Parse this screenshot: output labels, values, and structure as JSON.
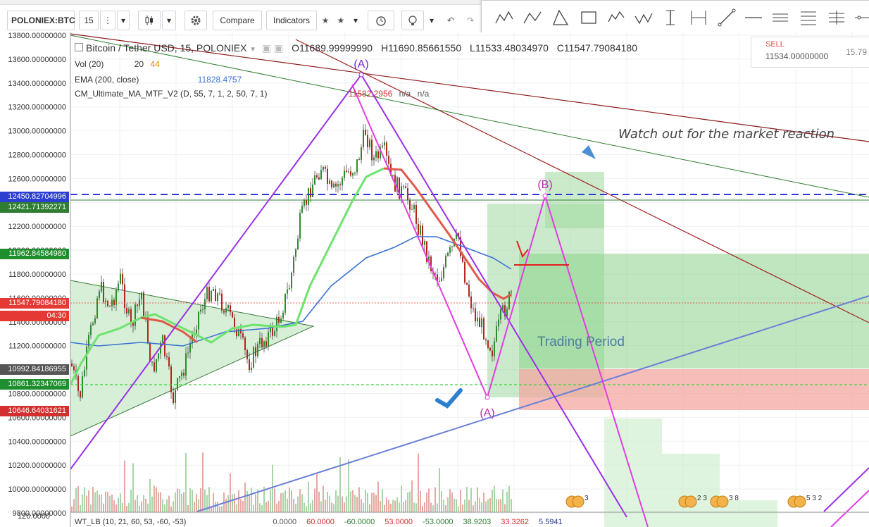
{
  "toolbar": {
    "symbol": "POLONIEX:BTC",
    "interval": "15",
    "compare_label": "Compare",
    "indicators_label": "Indicators"
  },
  "legend": {
    "title": "Bitcoin / Tether USD, 15, POLONIEX",
    "ohlc": {
      "o_label": "O",
      "o": "11689.99999990",
      "h_label": "H",
      "h": "11690.85661550",
      "l_label": "L",
      "l": "11533.48034970",
      "c_label": "C",
      "c": "11547.79084180"
    },
    "vol": {
      "name": "Vol (20)",
      "v1": "20",
      "v2": "44"
    },
    "ema": {
      "name": "EMA (200, close)",
      "value": "11828.4757"
    },
    "cm": {
      "name": "CM_Ultimate_MA_MTF_V2 (D, 55, 7, 1, 2, 50, 7, 1)",
      "value": "11582.2956",
      "na1": "n/a",
      "na2": "n/a"
    }
  },
  "order_panel": {
    "sell_label": "SELL",
    "sell_value": "11534.00000000",
    "right_value": "15.79"
  },
  "price_axis": {
    "ticks": [
      "13800.00000000",
      "13600.00000000",
      "13400.00000000",
      "13200.00000000",
      "13000.00000000",
      "12800.00000000",
      "12600.00000000",
      "12400.00000000",
      "12200.00000000",
      "12000.00000000",
      "11800.00000000",
      "11600.00000000",
      "11400.00000000",
      "11200.00000000",
      "11000.00000000",
      "10800.00000000",
      "10600.00000000",
      "10400.00000000",
      "10200.00000000",
      "10000.00000000",
      "9800.00000000"
    ],
    "bottom_label": "120.0000",
    "price_labels": [
      {
        "text": "12450.82704996",
        "color": "#2c3fd1"
      },
      {
        "text": "12421.71392271",
        "color": "#2e7d32"
      },
      {
        "text": "11962.84584980",
        "color": "#1e8e2e"
      },
      {
        "text": "11547.79084180",
        "color": "#e53935"
      },
      {
        "text": "04:30",
        "color": "#e53935"
      },
      {
        "text": "10992.84186955",
        "color": "#555555"
      },
      {
        "text": "10861.32347069",
        "color": "#1e8e2e"
      },
      {
        "text": "10646.64031621",
        "color": "#d32f2f"
      }
    ]
  },
  "annotations": {
    "watch_text": "Watch out for the market reaction",
    "trading_period": "Trading Period",
    "label_a_top": "(A)",
    "label_b": "(B)",
    "label_a_bottom": "(A)"
  },
  "bottom_indicator": {
    "name": "WT_LB (10, 21, 60, 53, -60, -53)",
    "values": [
      "0.0000",
      "60.0000",
      "-60.0000",
      "53.0000",
      "-53.0000",
      "38.9203",
      "33.3262",
      "5.5941"
    ],
    "colors": [
      "#555555",
      "#d32f2f",
      "#2e7d32",
      "#d32f2f",
      "#2e7d32",
      "#2e7d32",
      "#d32f2f",
      "#283593"
    ]
  },
  "event_badges": [
    "3",
    "2 3",
    "3 8",
    "5 3 2"
  ],
  "colors": {
    "green_zone": "#7ccf7c",
    "red_zone": "#f08c84",
    "blue_line": "#2b39d6",
    "pattern_violet": "#9b30e8",
    "pattern_magenta": "#e23de0",
    "ema_line": "#3b73d4",
    "ma_green": "#6de36d",
    "ma_red": "#e05a4b"
  }
}
